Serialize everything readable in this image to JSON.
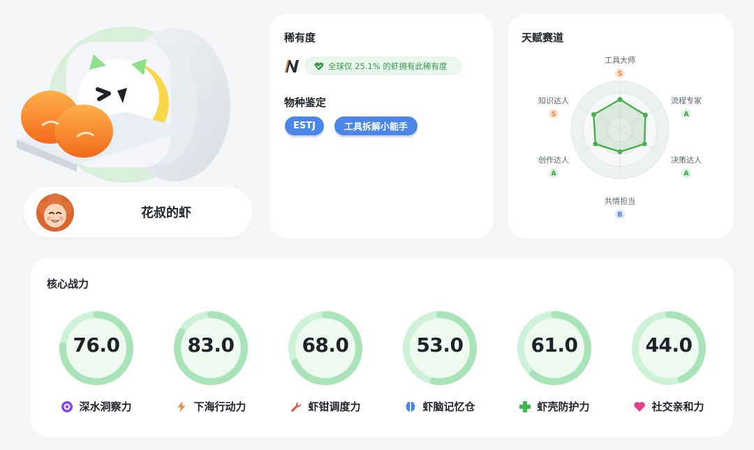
{
  "profile": {
    "name": "花叔的虾"
  },
  "rarity": {
    "title": "稀有度",
    "grade": "N",
    "badge_text": "全球仅 25.1% 的虾拥有此稀有度"
  },
  "species": {
    "title": "物种鉴定",
    "tags": [
      "ESTJ",
      "工具拆解小能手"
    ]
  },
  "talent": {
    "title": "天赋赛道",
    "axes": [
      {
        "label": "工具大师",
        "grade": "S",
        "value": 0.62
      },
      {
        "label": "流程专家",
        "grade": "A",
        "value": 0.6
      },
      {
        "label": "决策达人",
        "grade": "A",
        "value": 0.58
      },
      {
        "label": "共情担当",
        "grade": "B",
        "value": 0.45
      },
      {
        "label": "创作达人",
        "grade": "A",
        "value": 0.58
      },
      {
        "label": "知识达人",
        "grade": "S",
        "value": 0.62
      }
    ],
    "grade_colors": {
      "S": {
        "bg": "#fde6d4",
        "fg": "#e8823c"
      },
      "A": {
        "bg": "#dff5e3",
        "fg": "#3a9a4f"
      },
      "B": {
        "bg": "#dce8fb",
        "fg": "#4a7fd8"
      }
    },
    "line_color": "#4caf50"
  },
  "core": {
    "title": "核心战力",
    "stats": [
      {
        "value": "76.0",
        "percent": 76,
        "label": "深水洞察力",
        "icon": "eye-icon",
        "icon_color": "#8a3ffc"
      },
      {
        "value": "83.0",
        "percent": 83,
        "label": "下海行动力",
        "icon": "lightning-icon",
        "icon_color": "#f08a3c"
      },
      {
        "value": "68.0",
        "percent": 68,
        "label": "虾钳调度力",
        "icon": "wrench-icon",
        "icon_color": "#e5484d"
      },
      {
        "value": "53.0",
        "percent": 53,
        "label": "虾脑记忆仓",
        "icon": "brain-icon",
        "icon_color": "#4a86e8"
      },
      {
        "value": "61.0",
        "percent": 61,
        "label": "虾壳防护力",
        "icon": "shield-plus-icon",
        "icon_color": "#3fb950"
      },
      {
        "value": "44.0",
        "percent": 44,
        "label": "社交亲和力",
        "icon": "heart-icon",
        "icon_color": "#e83e8c"
      }
    ],
    "ring_track": "#cdf2d8",
    "ring_fill": "#a9e3b8"
  }
}
